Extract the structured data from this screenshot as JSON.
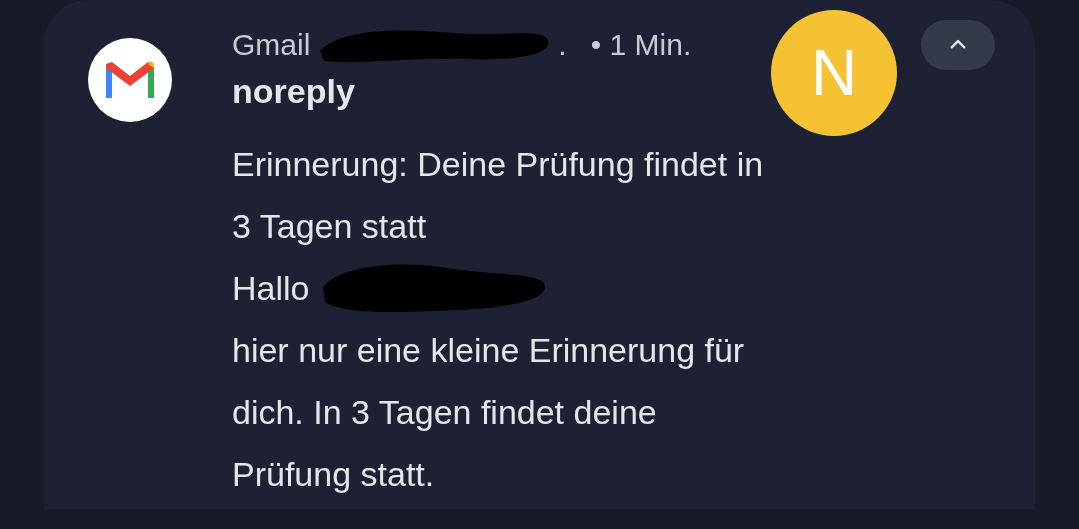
{
  "notification": {
    "app": "Gmail",
    "separator": ".",
    "time": "• 1 Min.",
    "sender": "noreply",
    "avatar_letter": "N",
    "expanded": true,
    "subject": "Erinnerung: Deine Prüfung findet in 3 Tagen statt",
    "greeting": "Hallo",
    "body": "hier nur eine kleine Erinnerung für dich. In 3 Tagen findet deine Prüfung statt."
  }
}
